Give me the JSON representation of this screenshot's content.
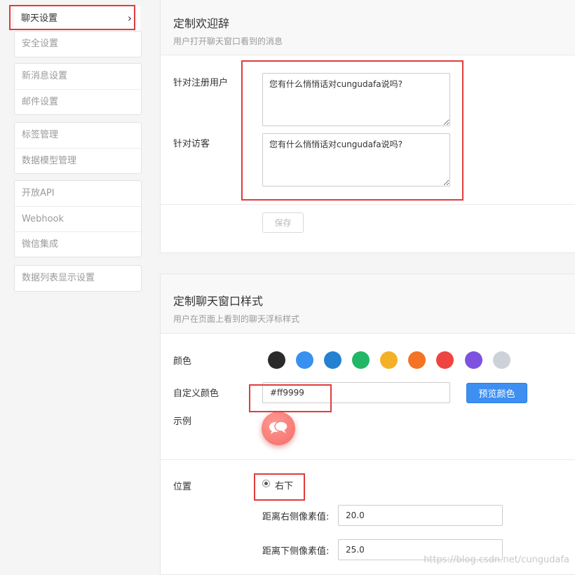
{
  "sidebar": {
    "active": {
      "label": "聊天设置",
      "icon": "chevron-right-icon"
    },
    "groups": [
      [
        "安全设置"
      ],
      [
        "新消息设置",
        "邮件设置"
      ],
      [
        "标签管理",
        "数据模型管理"
      ],
      [
        "开放API",
        "Webhook",
        "微信集成"
      ],
      [
        "数据列表显示设置"
      ]
    ]
  },
  "welcome": {
    "title": "定制欢迎辞",
    "subtitle": "用户打开聊天窗口看到的消息",
    "registered_label": "针对注册用户",
    "registered_value": "您有什么悄悄话对cungudafa说吗?",
    "visitor_label": "针对访客",
    "visitor_value": "您有什么悄悄话对cungudafa说吗?",
    "save_label": "保存"
  },
  "style": {
    "title": "定制聊天窗口样式",
    "subtitle": "用户在页面上看到的聊天浮标样式",
    "color_label": "颜色",
    "colors": [
      "#2b2b2b",
      "#3990f0",
      "#2481cf",
      "#21b766",
      "#f4b128",
      "#f27424",
      "#ee4540",
      "#7c52de",
      "#cdd2d8"
    ],
    "custom_color_label": "自定义颜色",
    "custom_color_value": "#ff9999",
    "preview_label": "预览颜色",
    "example_label": "示例",
    "bubble_icon": "chat-bubbles-icon",
    "position_label": "位置",
    "position_option": "右下",
    "right_offset_label": "距离右侧像素值:",
    "right_offset_value": "20.0",
    "bottom_offset_label": "距离下侧像素值:",
    "bottom_offset_value": "25.0"
  },
  "watermark": "https://blog.csdn.net/cungudafa",
  "annotation_color": "#e03c3c"
}
